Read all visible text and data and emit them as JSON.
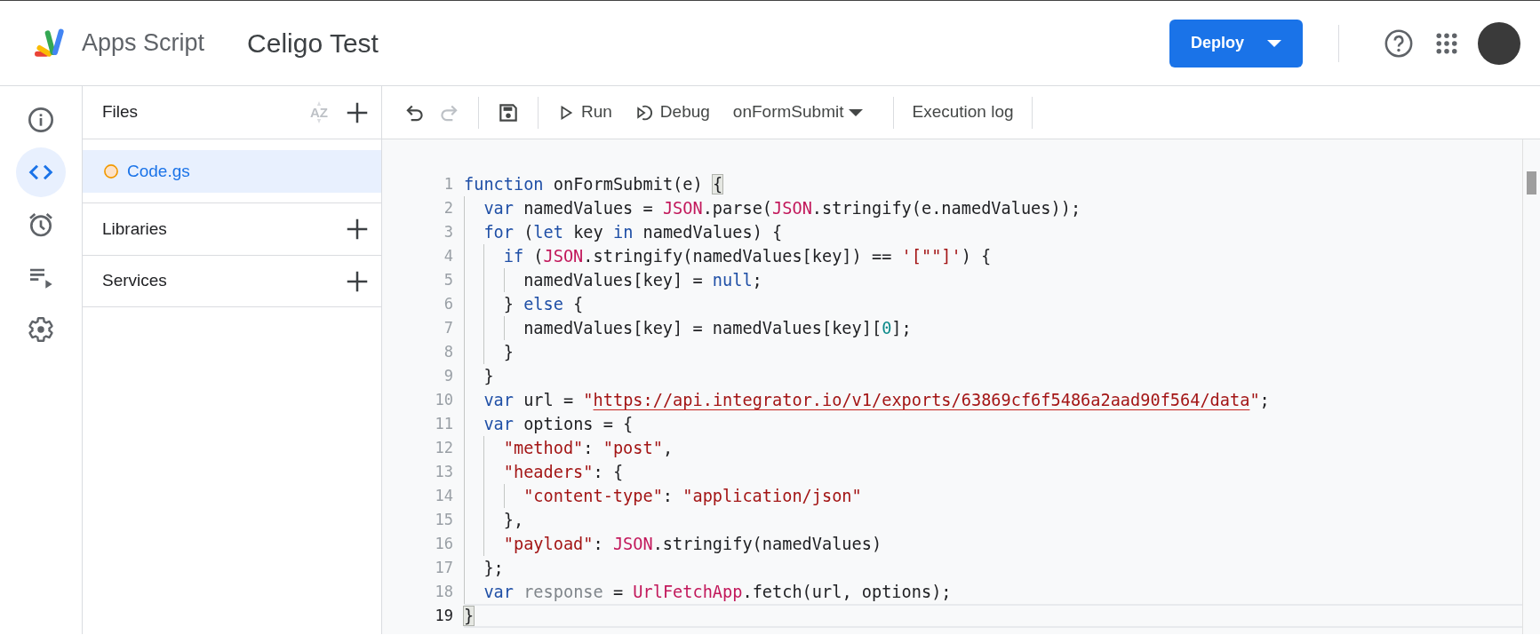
{
  "header": {
    "product_name": "Apps Script",
    "project_title": "Celigo Test",
    "deploy_button": "Deploy"
  },
  "sidebar": {
    "items": [
      {
        "kind": "info",
        "selected": false
      },
      {
        "kind": "editor",
        "selected": true
      },
      {
        "kind": "triggers",
        "selected": false
      },
      {
        "kind": "executions",
        "selected": false
      },
      {
        "kind": "settings",
        "selected": false
      }
    ]
  },
  "files_panel": {
    "title": "Files",
    "sort_label": "AZ",
    "files": [
      {
        "name": "Code.gs",
        "selected": true
      }
    ],
    "sections": [
      "Libraries",
      "Services"
    ]
  },
  "toolbar": {
    "items": [
      {
        "kind": "undo",
        "disabled": false
      },
      {
        "kind": "redo",
        "disabled": true
      },
      {
        "kind": "save",
        "disabled": false
      },
      {
        "kind": "run",
        "label": "Run"
      },
      {
        "kind": "debug",
        "label": "Debug"
      },
      {
        "kind": "function-select",
        "label": "onFormSubmit"
      },
      {
        "kind": "log",
        "label": "Execution log"
      }
    ]
  },
  "editor": {
    "lines": [
      {
        "number": "1",
        "current": false,
        "tokens": [
          {
            "kind": "kw",
            "text": "function"
          },
          {
            "kind": "plain",
            "text": " onFormSubmit(e) "
          },
          {
            "kind": "match",
            "text": "{"
          }
        ]
      },
      {
        "number": "2",
        "current": false,
        "tokens": [
          {
            "kind": "kw",
            "text": "  var"
          },
          {
            "kind": "plain",
            "text": " namedValues = "
          },
          {
            "kind": "builtin",
            "text": "JSON"
          },
          {
            "kind": "plain",
            "text": ".parse("
          },
          {
            "kind": "builtin",
            "text": "JSON"
          },
          {
            "kind": "plain",
            "text": ".stringify(e.namedValues));"
          }
        ]
      },
      {
        "number": "3",
        "current": false,
        "tokens": [
          {
            "kind": "kw",
            "text": "  for"
          },
          {
            "kind": "plain",
            "text": " ("
          },
          {
            "kind": "kw",
            "text": "let"
          },
          {
            "kind": "plain",
            "text": " key "
          },
          {
            "kind": "kw",
            "text": "in"
          },
          {
            "kind": "plain",
            "text": " namedValues) {"
          }
        ]
      },
      {
        "number": "4",
        "current": false,
        "tokens": [
          {
            "kind": "kw",
            "text": "    if"
          },
          {
            "kind": "plain",
            "text": " ("
          },
          {
            "kind": "builtin",
            "text": "JSON"
          },
          {
            "kind": "plain",
            "text": ".stringify(namedValues[key]) == "
          },
          {
            "kind": "str",
            "text": "'[\"\"]'"
          },
          {
            "kind": "plain",
            "text": ") {"
          }
        ]
      },
      {
        "number": "5",
        "current": false,
        "tokens": [
          {
            "kind": "plain",
            "text": "      namedValues[key] = "
          },
          {
            "kind": "kw",
            "text": "null"
          },
          {
            "kind": "plain",
            "text": ";"
          }
        ]
      },
      {
        "number": "6",
        "current": false,
        "tokens": [
          {
            "kind": "plain",
            "text": "    } "
          },
          {
            "kind": "kw",
            "text": "else"
          },
          {
            "kind": "plain",
            "text": " {"
          }
        ]
      },
      {
        "number": "7",
        "current": false,
        "tokens": [
          {
            "kind": "plain",
            "text": "      namedValues[key] = namedValues[key]["
          },
          {
            "kind": "num",
            "text": "0"
          },
          {
            "kind": "plain",
            "text": "];"
          }
        ]
      },
      {
        "number": "8",
        "current": false,
        "tokens": [
          {
            "kind": "plain",
            "text": "    }"
          }
        ]
      },
      {
        "number": "9",
        "current": false,
        "tokens": [
          {
            "kind": "plain",
            "text": "  }"
          }
        ]
      },
      {
        "number": "10",
        "current": false,
        "tokens": [
          {
            "kind": "kw",
            "text": "  var"
          },
          {
            "kind": "plain",
            "text": " url = "
          },
          {
            "kind": "str",
            "text": "\""
          },
          {
            "kind": "url",
            "text": "https://api.integrator.io/v1/exports/63869cf6f5486a2aad90f564/data"
          },
          {
            "kind": "str",
            "text": "\""
          },
          {
            "kind": "plain",
            "text": ";"
          }
        ]
      },
      {
        "number": "11",
        "current": false,
        "tokens": [
          {
            "kind": "kw",
            "text": "  var"
          },
          {
            "kind": "plain",
            "text": " options = {"
          }
        ]
      },
      {
        "number": "12",
        "current": false,
        "tokens": [
          {
            "kind": "str",
            "text": "    \"method\""
          },
          {
            "kind": "plain",
            "text": ": "
          },
          {
            "kind": "str",
            "text": "\"post\""
          },
          {
            "kind": "plain",
            "text": ","
          }
        ]
      },
      {
        "number": "13",
        "current": false,
        "tokens": [
          {
            "kind": "str",
            "text": "    \"headers\""
          },
          {
            "kind": "plain",
            "text": ": {"
          }
        ]
      },
      {
        "number": "14",
        "current": false,
        "tokens": [
          {
            "kind": "str",
            "text": "      \"content-type\""
          },
          {
            "kind": "plain",
            "text": ": "
          },
          {
            "kind": "str",
            "text": "\"application/json\""
          }
        ]
      },
      {
        "number": "15",
        "current": false,
        "tokens": [
          {
            "kind": "plain",
            "text": "    },"
          }
        ]
      },
      {
        "number": "16",
        "current": false,
        "tokens": [
          {
            "kind": "str",
            "text": "    \"payload\""
          },
          {
            "kind": "plain",
            "text": ": "
          },
          {
            "kind": "builtin",
            "text": "JSON"
          },
          {
            "kind": "plain",
            "text": ".stringify(namedValues)"
          }
        ]
      },
      {
        "number": "17",
        "current": false,
        "tokens": [
          {
            "kind": "plain",
            "text": "  };"
          }
        ]
      },
      {
        "number": "18",
        "current": false,
        "tokens": [
          {
            "kind": "kw",
            "text": "  var"
          },
          {
            "kind": "dim",
            "text": " response"
          },
          {
            "kind": "plain",
            "text": " = "
          },
          {
            "kind": "builtin",
            "text": "UrlFetchApp"
          },
          {
            "kind": "plain",
            "text": ".fetch(url, options);"
          }
        ]
      },
      {
        "number": "19",
        "current": true,
        "tokens": [
          {
            "kind": "match",
            "text": "}"
          }
        ]
      }
    ]
  }
}
